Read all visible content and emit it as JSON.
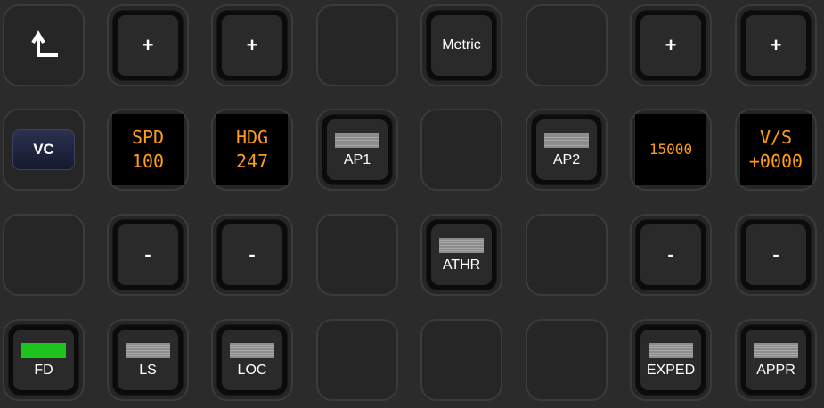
{
  "panel": {
    "back_label": "back",
    "rows": [
      [
        {
          "kind": "back"
        },
        {
          "kind": "btn",
          "symbol": "+"
        },
        {
          "kind": "btn",
          "symbol": "+"
        },
        {
          "kind": "empty"
        },
        {
          "kind": "btn",
          "label": "Metric"
        },
        {
          "kind": "empty"
        },
        {
          "kind": "btn",
          "symbol": "+"
        },
        {
          "kind": "btn",
          "symbol": "+"
        }
      ],
      [
        {
          "kind": "vc",
          "label": "VC"
        },
        {
          "kind": "lcd",
          "line1": "SPD",
          "line2": "100"
        },
        {
          "kind": "lcd",
          "line1": "HDG",
          "line2": "247"
        },
        {
          "kind": "btn",
          "label": "AP1",
          "indicator": "off"
        },
        {
          "kind": "empty"
        },
        {
          "kind": "btn",
          "label": "AP2",
          "indicator": "off"
        },
        {
          "kind": "lcd",
          "line1": "15000",
          "single": true
        },
        {
          "kind": "lcd",
          "line1": "V/S",
          "line2": "+0000"
        }
      ],
      [
        {
          "kind": "empty"
        },
        {
          "kind": "btn",
          "symbol": "-"
        },
        {
          "kind": "btn",
          "symbol": "-"
        },
        {
          "kind": "empty"
        },
        {
          "kind": "btn",
          "label": "ATHR",
          "indicator": "off"
        },
        {
          "kind": "empty"
        },
        {
          "kind": "btn",
          "symbol": "-"
        },
        {
          "kind": "btn",
          "symbol": "-"
        }
      ],
      [
        {
          "kind": "btn",
          "label": "FD",
          "indicator": "on"
        },
        {
          "kind": "btn",
          "label": "LS",
          "indicator": "off"
        },
        {
          "kind": "btn",
          "label": "LOC",
          "indicator": "off"
        },
        {
          "kind": "empty"
        },
        {
          "kind": "empty"
        },
        {
          "kind": "empty"
        },
        {
          "kind": "btn",
          "label": "EXPED",
          "indicator": "off"
        },
        {
          "kind": "btn",
          "label": "APPR",
          "indicator": "off"
        }
      ]
    ]
  },
  "colors": {
    "indicator_on": "#1ec41e",
    "indicator_off": "#9a9a9a",
    "lcd_text": "#ff9d1a",
    "background": "#2b2b2b"
  }
}
